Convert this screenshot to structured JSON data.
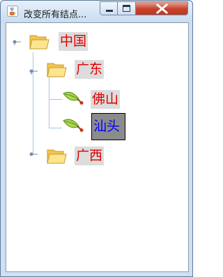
{
  "window": {
    "title": "改变所有结点...",
    "app_icon": "java-cup-icon",
    "colors": {
      "tree_text": "#e00000",
      "selected_text": "#0000ff",
      "selected_bg": "#8b8b8b",
      "label_bg": "#dcdcdc"
    }
  },
  "tree": {
    "nodes": [
      {
        "label": "中国",
        "icon": "folder-open-icon",
        "expanded": true,
        "selected": false
      },
      {
        "label": "广东",
        "icon": "folder-open-icon",
        "expanded": true,
        "selected": false
      },
      {
        "label": "佛山",
        "icon": "leaf-icon",
        "selected": false
      },
      {
        "label": "汕头",
        "icon": "leaf-icon",
        "selected": true
      },
      {
        "label": "广西",
        "icon": "folder-open-icon",
        "expanded": false,
        "selected": false
      }
    ]
  }
}
